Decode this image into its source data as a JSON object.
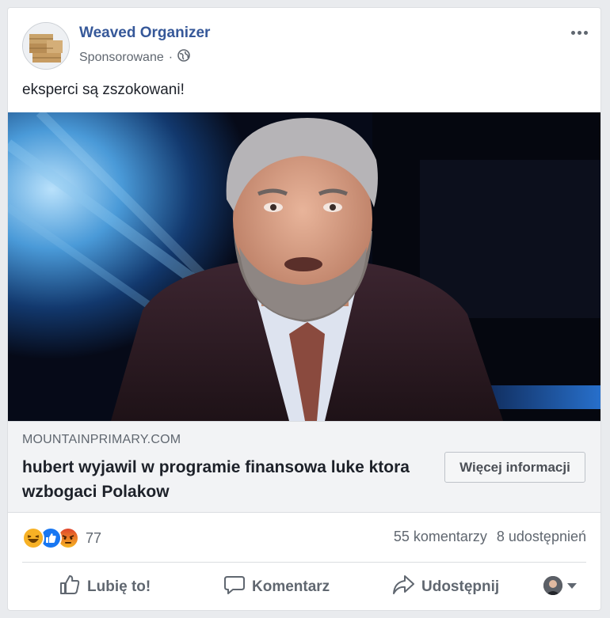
{
  "post": {
    "page_name": "Weaved Organizer",
    "sponsored_label": "Sponsorowane",
    "separator": "·",
    "privacy_icon": "globe-icon",
    "more_icon": "more-options-icon",
    "text": "eksperci są zszokowani!"
  },
  "link": {
    "domain": "MOUNTAINPRIMARY.COM",
    "headline": "hubert wyjawil w programie finansowa luke ktora wzbogaci Polakow",
    "cta_label": "Więcej informacji"
  },
  "stats": {
    "reaction_icons": [
      "haha-icon",
      "like-icon",
      "angry-icon"
    ],
    "reaction_count": "77",
    "comments": "55 komentarzy",
    "shares": "8 udostępnień"
  },
  "actions": {
    "like_label": "Lubię to!",
    "comment_label": "Komentarz",
    "share_label": "Udostępnij"
  },
  "colors": {
    "page_name": "#365899",
    "muted": "#606770",
    "like_blue": "#1877f2",
    "haha_yellow": "#f7b125",
    "angry_red": "#e9710f"
  }
}
